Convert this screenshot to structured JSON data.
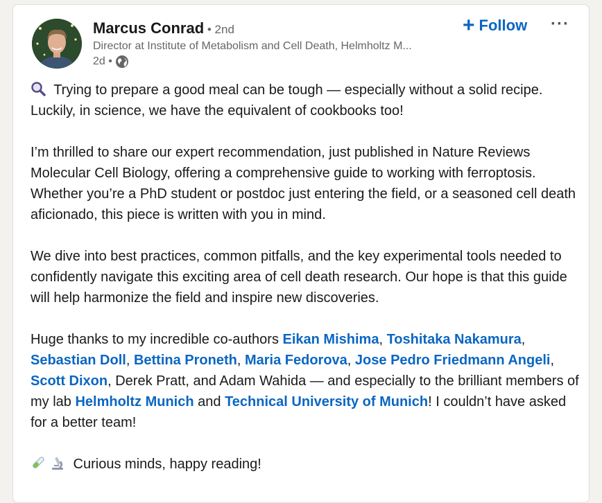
{
  "author": {
    "name": "Marcus Conrad",
    "degree": " • 2nd",
    "headline": "Director at Institute of Metabolism and Cell Death, Helmholtz M...",
    "time": "2d •",
    "avatar_icon": "profile-photo",
    "visibility_icon": "globe-icon"
  },
  "actions": {
    "follow_plus": "+",
    "follow_label": "Follow",
    "more_label": "···"
  },
  "post": {
    "p1_icon": "magnifier-emoji",
    "p1_text": " Trying to prepare a good meal can be tough — especially without a solid recipe. Luckily, in science, we have the equivalent of cookbooks too!",
    "p2": "I’m thrilled to share our expert recommendation, just published in Nature Reviews Molecular Cell Biology, offering a comprehensive guide to working with ferroptosis. Whether you’re a PhD student or postdoc just entering the field, or a seasoned cell death aficionado, this piece is written with you in mind.",
    "p3": "We dive into best practices, common pitfalls, and the key experimental tools needed to confidently navigate this exciting area of cell death research. Our hope is that this guide will help harmonize the field and inspire new discoveries.",
    "p4": {
      "t0": "Huge thanks to my incredible co-authors ",
      "m1": "Eikan Mishima",
      "s1": ", ",
      "m2": "Toshitaka Nakamura",
      "s2": ", ",
      "m3": "Sebastian Doll",
      "s3": ", ",
      "m4": "Bettina Proneth",
      "s4": ", ",
      "m5": "Maria Fedorova",
      "s5": ", ",
      "m6": "Jose Pedro Friedmann Angeli",
      "s6": ", ",
      "m7": "Scott Dixon",
      "t1": ", Derek Pratt, and Adam Wahida — and especially to the brilliant members of my lab ",
      "m8": "Helmholtz Munich",
      "t2": " and ",
      "m9": "Technical University of Munich",
      "t3": "! I couldn’t have asked for a better team!"
    },
    "p5_icons": [
      "test-tube-emoji",
      "microscope-emoji"
    ],
    "p5_text": " Curious minds, happy reading!"
  },
  "colors": {
    "link": "#0a66c2",
    "muted": "#666666",
    "background": "#f4f2ee"
  }
}
